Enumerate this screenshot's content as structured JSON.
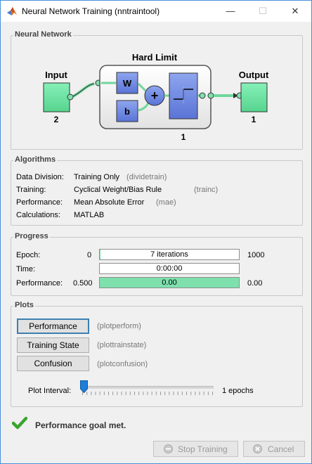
{
  "window": {
    "title": "Neural Network Training (nntraintool)",
    "minimize": "—",
    "maximize": "☐",
    "close": "✕"
  },
  "network": {
    "panel_title": "Neural Network",
    "layer_title": "Hard Limit",
    "input_label": "Input",
    "input_size": "2",
    "weight_label": "W",
    "bias_label": "b",
    "layer_size": "1",
    "output_label": "Output",
    "output_size": "1"
  },
  "algorithms": {
    "panel_title": "Algorithms",
    "rows": [
      {
        "label": "Data Division:",
        "value": "Training Only",
        "code": "(dividetrain)"
      },
      {
        "label": "Training:",
        "value": "Cyclical Weight/Bias Rule",
        "code": "(trainc)"
      },
      {
        "label": "Performance:",
        "value": "Mean Absolute Error",
        "code": "(mae)"
      },
      {
        "label": "Calculations:",
        "value": "MATLAB",
        "code": ""
      }
    ]
  },
  "progress": {
    "panel_title": "Progress",
    "epoch": {
      "label": "Epoch:",
      "start": "0",
      "text": "7 iterations",
      "end": "1000",
      "fill": 0.007
    },
    "time": {
      "label": "Time:",
      "text": "0:00:00"
    },
    "performance": {
      "label": "Performance:",
      "start": "0.500",
      "text": "0.00",
      "end": "0.00",
      "fill": 1.0
    }
  },
  "plots": {
    "panel_title": "Plots",
    "buttons": [
      {
        "label": "Performance",
        "code": "(plotperform)"
      },
      {
        "label": "Training State",
        "code": "(plottrainstate)"
      },
      {
        "label": "Confusion",
        "code": "(plotconfusion)"
      }
    ],
    "interval_label": "Plot Interval:",
    "interval_value": "1 epochs",
    "interval_level": 0.0
  },
  "status": {
    "message": "Performance goal met."
  },
  "footer": {
    "stop_label": "Stop Training",
    "cancel_label": "Cancel"
  },
  "colors": {
    "green_box": "#6ee8a2",
    "blue_box": "#6b86e0",
    "progress_fill": "#7ee0ac",
    "check": "#3aa52e"
  }
}
